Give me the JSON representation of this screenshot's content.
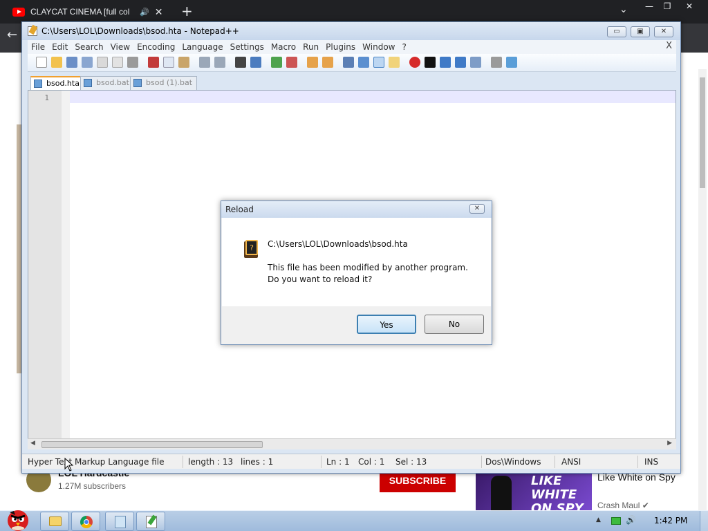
{
  "browser": {
    "tab_title": "CLAYCAT CINEMA [full col",
    "speaker_glyph": "🔊",
    "close_glyph": "✕",
    "new_tab_glyph": "+",
    "chevron_glyph": "⌄",
    "back_glyph": "←",
    "min_glyph": "—",
    "max_glyph": "❐",
    "close_win_glyph": "✕"
  },
  "youtube": {
    "channel_name": "LOL Hardcastle",
    "subscribers": "1.27M subscribers",
    "subscribe_label": "SUBSCRIBE",
    "thumb_text": "LIKE WHITE ON SPY",
    "video_title": "Like White on Spy",
    "video_channel": "Crash Maul ✔"
  },
  "npp": {
    "title": "C:\\Users\\LOL\\Downloads\\bsod.hta - Notepad++",
    "min_label": "▭",
    "max_label": "▣",
    "close_label": "✕",
    "menu_close": "X",
    "menu": [
      "File",
      "Edit",
      "Search",
      "View",
      "Encoding",
      "Language",
      "Settings",
      "Macro",
      "Run",
      "Plugins",
      "Window",
      "?"
    ],
    "tabs": [
      {
        "label": "bsod.hta",
        "active": true
      },
      {
        "label": "bsod.bat",
        "active": false
      },
      {
        "label": "bsod (1).bat",
        "active": false
      }
    ],
    "line_number": "1",
    "line_text": "",
    "status": {
      "file_type": "Hyper Text Markup Language file",
      "length": "length : 13",
      "lines": "lines : 1",
      "ln": "Ln : 1",
      "col": "Col : 1",
      "sel": "Sel : 13",
      "eol": "Dos\\Windows",
      "encoding": "ANSI",
      "mode": "INS"
    }
  },
  "dialog": {
    "title": "Reload",
    "close_glyph": "✕",
    "path": "C:\\Users\\LOL\\Downloads\\bsod.hta",
    "line1": "This file has been modified by another program.",
    "line2": "Do you want to reload it?",
    "yes": "Yes",
    "no": "No"
  },
  "taskbar": {
    "time": "1:42 PM",
    "tray_up": "▲",
    "speaker": "🔊"
  }
}
